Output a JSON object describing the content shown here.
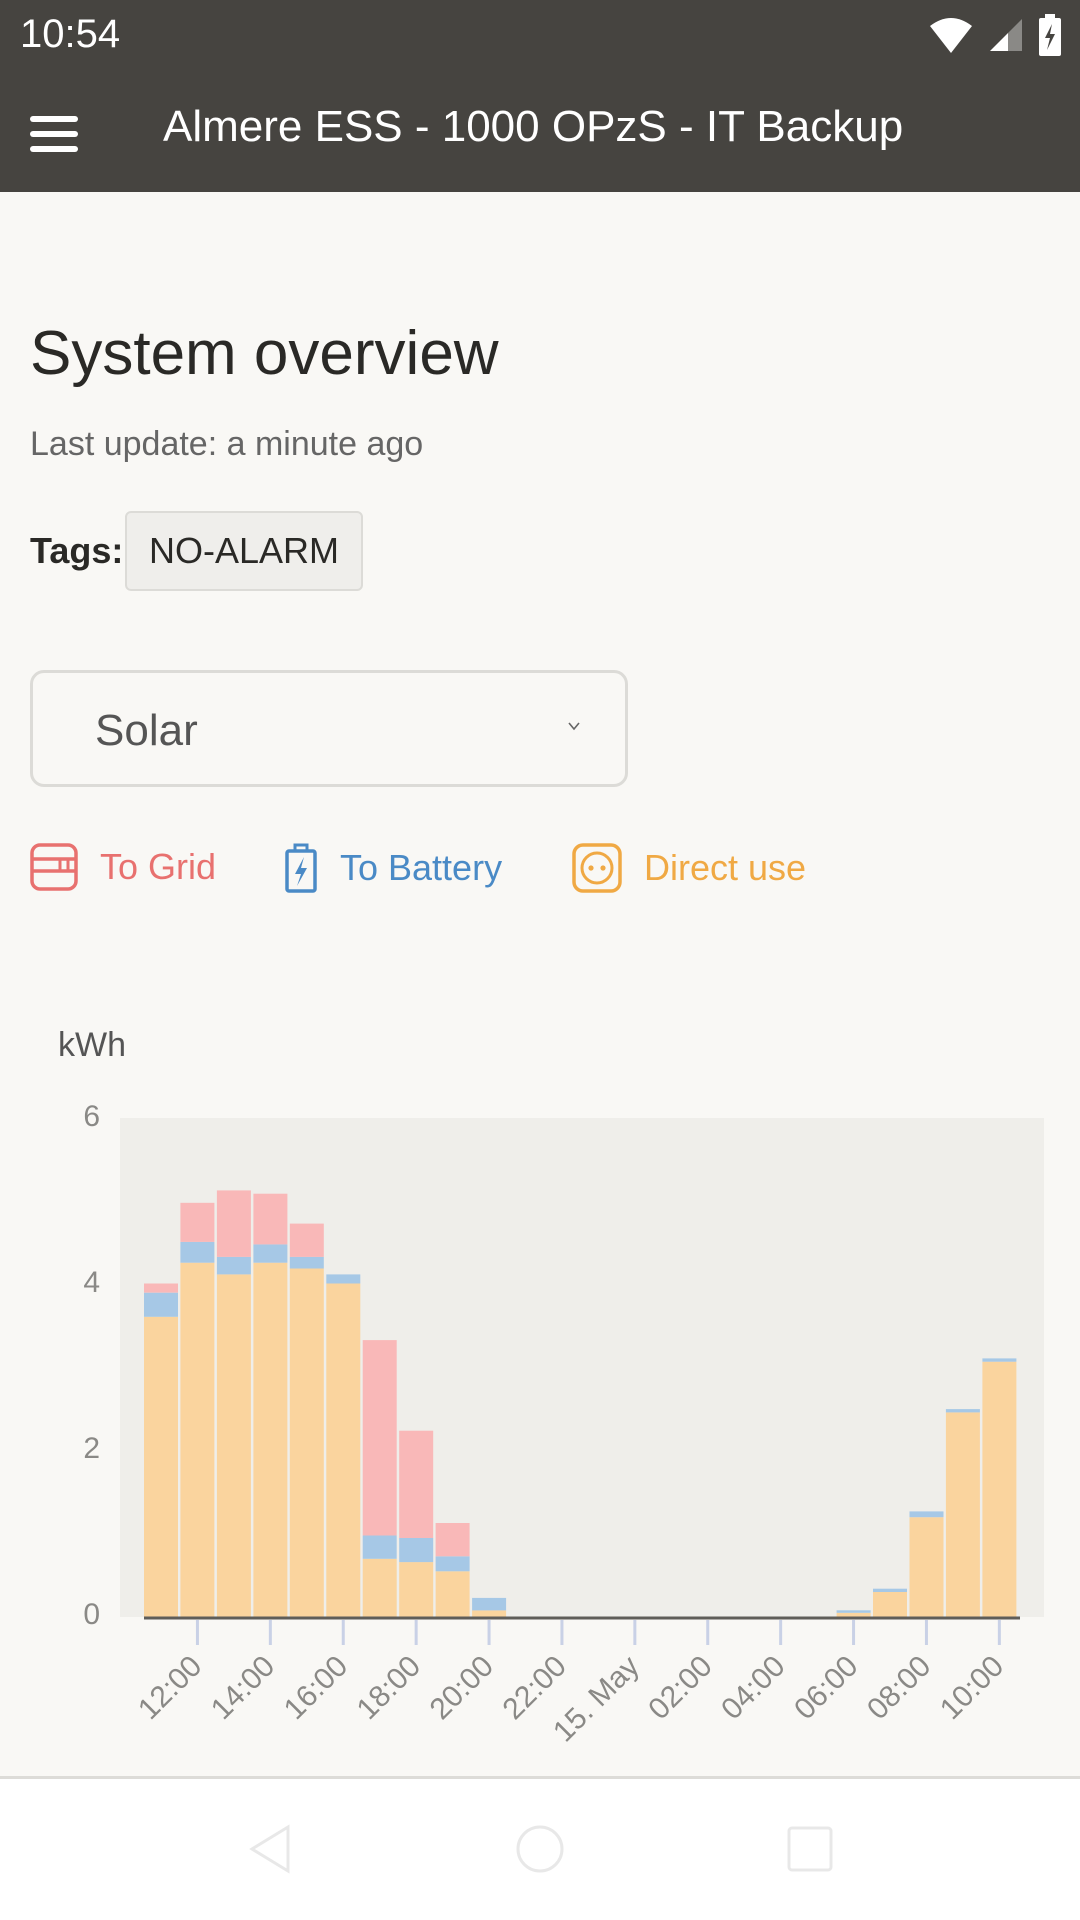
{
  "status_bar": {
    "time": "10:54",
    "icons": [
      "wifi-icon",
      "signal-icon",
      "battery-charging-icon"
    ]
  },
  "app_bar": {
    "menu_icon": "hamburger-menu-icon",
    "title": "Almere ESS - 1000 OPzS - IT Backup"
  },
  "page": {
    "title": "System overview",
    "last_update": "Last update: a minute ago",
    "tags_label": "Tags:",
    "tags": [
      "NO-ALARM"
    ]
  },
  "source_select": {
    "selected": "Solar"
  },
  "legend": [
    {
      "label": "To Grid",
      "icon": "grid-meter-icon",
      "color": "#e8716f"
    },
    {
      "label": "To Battery",
      "icon": "battery-icon",
      "color": "#4a8ac6"
    },
    {
      "label": "Direct use",
      "icon": "power-socket-icon",
      "color": "#f0a944"
    }
  ],
  "navigation_bar": {
    "buttons": [
      "back-icon",
      "home-icon",
      "recents-icon"
    ]
  },
  "chart_data": {
    "type": "bar",
    "stacked": true,
    "title": "",
    "ylabel": "kWh",
    "xlabel": "",
    "ylim": [
      0,
      6
    ],
    "yticks": [
      "0",
      "2",
      "4",
      "6"
    ],
    "xtick_labels": [
      "12:00",
      "14:00",
      "16:00",
      "18:00",
      "20:00",
      "22:00",
      "15. May",
      "02:00",
      "04:00",
      "06:00",
      "08:00",
      "10:00"
    ],
    "categories": [
      "11:00",
      "12:00",
      "13:00",
      "14:00",
      "15:00",
      "16:00",
      "17:00",
      "18:00",
      "19:00",
      "20:00",
      "21:00",
      "22:00",
      "23:00",
      "00:00",
      "01:00",
      "02:00",
      "03:00",
      "04:00",
      "05:00",
      "06:00",
      "07:00",
      "08:00",
      "09:00",
      "10:00"
    ],
    "series": [
      {
        "name": "Direct use",
        "color": "#fad49e",
        "values": [
          3.61,
          4.26,
          4.12,
          4.26,
          4.19,
          4.01,
          0.7,
          0.66,
          0.55,
          0.08,
          0,
          0,
          0,
          0,
          0,
          0,
          0,
          0,
          0,
          0.05,
          0.3,
          1.2,
          2.46,
          3.07
        ]
      },
      {
        "name": "To Battery",
        "color": "#a6c8e6",
        "values": [
          0.29,
          0.25,
          0.21,
          0.22,
          0.14,
          0.11,
          0.28,
          0.29,
          0.18,
          0.15,
          0,
          0,
          0,
          0,
          0,
          0,
          0,
          0,
          0,
          0.03,
          0.04,
          0.07,
          0.04,
          0.04
        ]
      },
      {
        "name": "To Grid",
        "color": "#f9b8b8",
        "values": [
          0.11,
          0.47,
          0.8,
          0.61,
          0.4,
          0,
          2.35,
          1.29,
          0.4,
          0,
          0,
          0,
          0,
          0,
          0,
          0,
          0,
          0,
          0,
          0,
          0,
          0,
          0,
          0
        ]
      }
    ],
    "grid": false,
    "legend": "top-left"
  }
}
